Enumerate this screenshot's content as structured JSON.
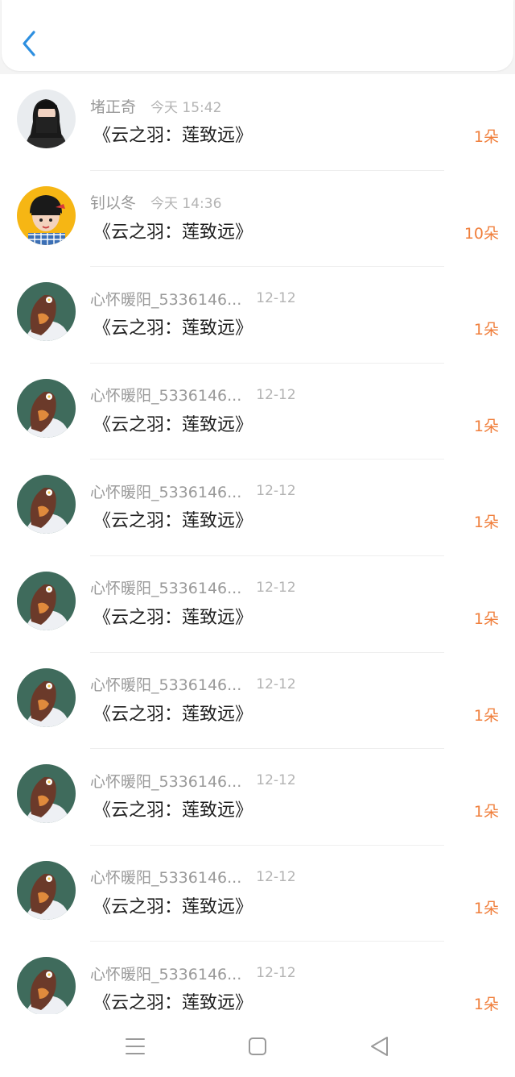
{
  "header": {
    "back_icon": "chevron-left-icon",
    "accent_color": "#2d8fe0"
  },
  "items": [
    {
      "name": "堵正奇",
      "time": "今天 15:42",
      "title": "《云之羽：莲致远》",
      "count": "1朵",
      "avatar": "avatar-girl-icon"
    },
    {
      "name": "钊以冬",
      "time": "今天 14:36",
      "title": "《云之羽：莲致远》",
      "count": "10朵",
      "avatar": "avatar-cartoon-icon"
    },
    {
      "name": "心怀暖阳_5336146...",
      "time": "12-12",
      "title": "《云之羽：莲致远》",
      "count": "1朵",
      "avatar": "avatar-flower-girl-icon"
    },
    {
      "name": "心怀暖阳_5336146...",
      "time": "12-12",
      "title": "《云之羽：莲致远》",
      "count": "1朵",
      "avatar": "avatar-flower-girl-icon"
    },
    {
      "name": "心怀暖阳_5336146...",
      "time": "12-12",
      "title": "《云之羽：莲致远》",
      "count": "1朵",
      "avatar": "avatar-flower-girl-icon"
    },
    {
      "name": "心怀暖阳_5336146...",
      "time": "12-12",
      "title": "《云之羽：莲致远》",
      "count": "1朵",
      "avatar": "avatar-flower-girl-icon"
    },
    {
      "name": "心怀暖阳_5336146...",
      "time": "12-12",
      "title": "《云之羽：莲致远》",
      "count": "1朵",
      "avatar": "avatar-flower-girl-icon"
    },
    {
      "name": "心怀暖阳_5336146...",
      "time": "12-12",
      "title": "《云之羽：莲致远》",
      "count": "1朵",
      "avatar": "avatar-flower-girl-icon"
    },
    {
      "name": "心怀暖阳_5336146...",
      "time": "12-12",
      "title": "《云之羽：莲致远》",
      "count": "1朵",
      "avatar": "avatar-flower-girl-icon"
    },
    {
      "name": "心怀暖阳_5336146...",
      "time": "12-12",
      "title": "《云之羽：莲致远》",
      "count": "1朵",
      "avatar": "avatar-flower-girl-icon"
    }
  ],
  "count_color": "#f07f3c",
  "navbar": {
    "menu_icon": "menu-icon",
    "home_icon": "home-square-icon",
    "back_icon": "back-triangle-icon"
  }
}
